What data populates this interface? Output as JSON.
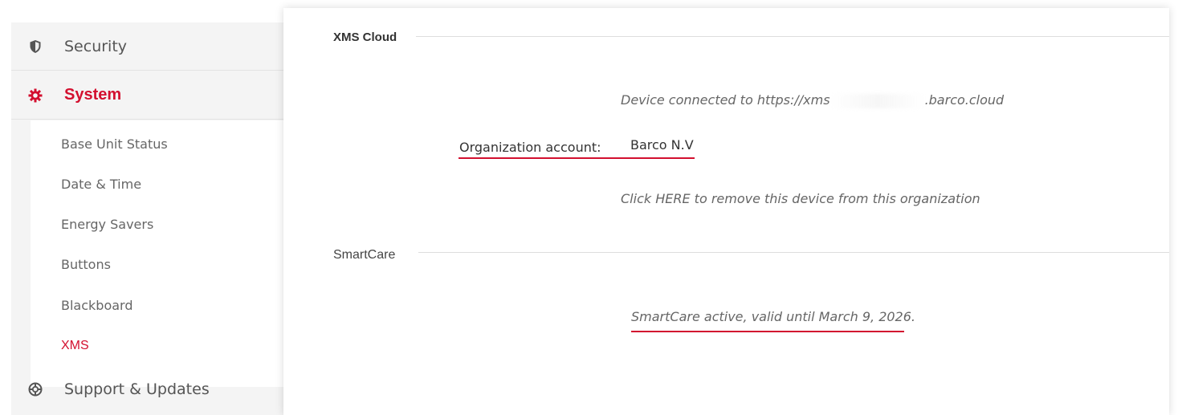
{
  "sidebar": {
    "sections": [
      {
        "label": "Security",
        "icon": "shield-icon"
      },
      {
        "label": "System",
        "icon": "gear-icon"
      },
      {
        "label": "Support & Updates",
        "icon": "lifebuoy-icon"
      }
    ],
    "system_items": [
      {
        "label": "Base Unit Status"
      },
      {
        "label": "Date & Time"
      },
      {
        "label": "Energy Savers"
      },
      {
        "label": "Buttons"
      },
      {
        "label": "Blackboard"
      },
      {
        "label": "XMS"
      }
    ]
  },
  "xms_cloud": {
    "title": "XMS Cloud",
    "connection_prefix": "Device connected to https://xms",
    "connection_suffix": ".barco.cloud",
    "org_label": "Organization account:",
    "org_value": "Barco N.V",
    "remove_link": "Click HERE to remove this device from this organization"
  },
  "smartcare": {
    "title": "SmartCare",
    "status": "SmartCare active, valid until March 9, 2026."
  },
  "colors": {
    "accent": "#d3102f",
    "sidebar_bg": "#f4f4f4",
    "text": "#555555"
  }
}
